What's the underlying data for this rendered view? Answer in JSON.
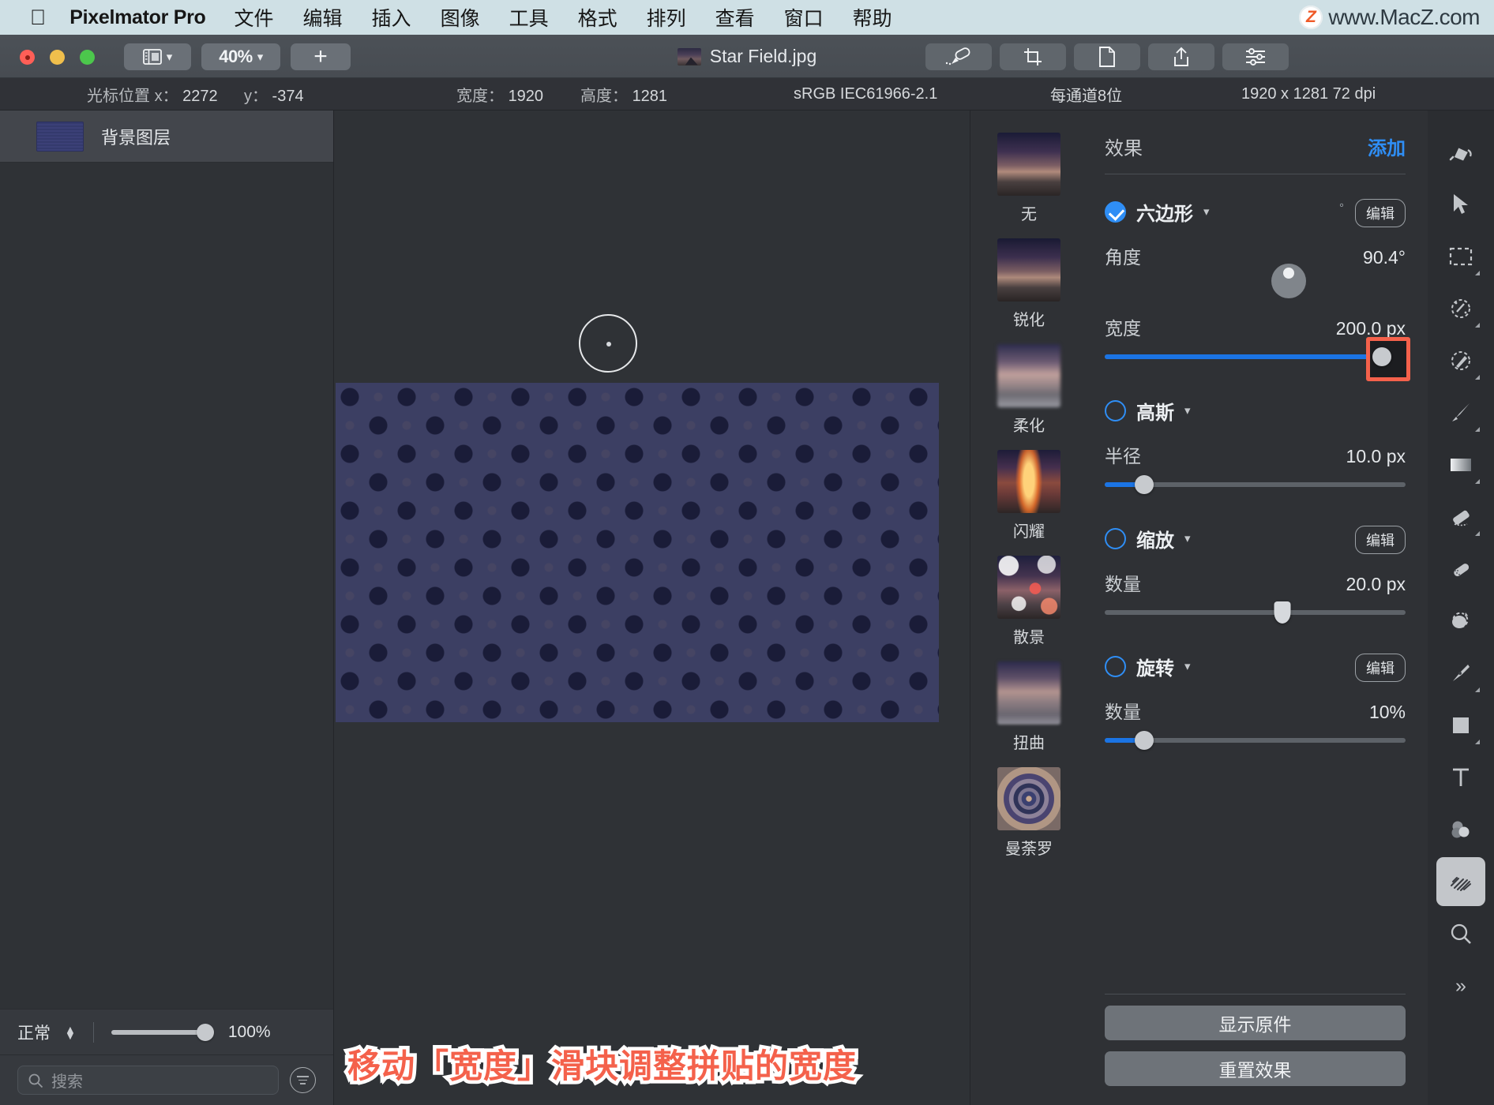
{
  "menubar": {
    "apple_icon": "apple-logo-icon",
    "app_name": "Pixelmator Pro",
    "items": [
      "文件",
      "编辑",
      "插入",
      "图像",
      "工具",
      "格式",
      "排列",
      "查看",
      "窗口",
      "帮助"
    ],
    "watermark_badge": "Z",
    "watermark_text": "www.MacZ.com"
  },
  "titlebar": {
    "zoom_level": "40%",
    "document_title": "Star Field.jpg",
    "add_label": "+",
    "tools": [
      "paint-tool-icon",
      "crop-tool-icon",
      "document-icon",
      "share-icon",
      "adjustments-icon"
    ]
  },
  "infobar": {
    "cursor_label": "光标位置",
    "x_label": "x：",
    "x_value": "2272",
    "y_label": "y：",
    "y_value": "-374",
    "width_label": "宽度：",
    "width_value": "1920",
    "height_label": "高度：",
    "height_value": "1281",
    "color_profile": "sRGB IEC61966-2.1",
    "bit_depth": "每通道8位",
    "dimensions_dpi": "1920 x 1281 72 dpi"
  },
  "left_panel": {
    "layer_name": "背景图层",
    "blend_mode": "正常",
    "opacity": "100%",
    "search_placeholder": "搜索"
  },
  "canvas": {
    "annotation": "移动「宽度」滑块调整拼贴的宽度"
  },
  "right_panel": {
    "effects_title": "效果",
    "add_label": "添加",
    "presets": [
      {
        "label": "无",
        "thumb": "t-none"
      },
      {
        "label": "锐化",
        "thumb": "t-sharp"
      },
      {
        "label": "柔化",
        "thumb": "t-soft"
      },
      {
        "label": "闪耀",
        "thumb": "t-glow"
      },
      {
        "label": "散景",
        "thumb": "t-bokeh"
      },
      {
        "label": "扭曲",
        "thumb": "t-twist"
      },
      {
        "label": "曼荼罗",
        "thumb": "t-mandala"
      }
    ],
    "effects": [
      {
        "name": "六边形",
        "enabled": true,
        "edit_label": "编辑",
        "params": [
          {
            "label": "角度",
            "value": "90.4°",
            "fill_pct": 0
          },
          {
            "label": "宽度",
            "value": "200.0 px",
            "fill_pct": 92
          }
        ]
      },
      {
        "name": "高斯",
        "enabled": false,
        "params": [
          {
            "label": "半径",
            "value": "10.0 px",
            "fill_pct": 13
          }
        ]
      },
      {
        "name": "缩放",
        "enabled": false,
        "edit_label": "编辑",
        "params": [
          {
            "label": "数量",
            "value": "20.0 px",
            "fill_pct": 59
          }
        ]
      },
      {
        "name": "旋转",
        "enabled": false,
        "edit_label": "编辑",
        "params": [
          {
            "label": "数量",
            "value": "10%",
            "fill_pct": 13
          }
        ]
      }
    ],
    "show_original_label": "显示原件",
    "reset_effects_label": "重置效果"
  },
  "toolstrip": {
    "tools": [
      "paint-bucket-icon",
      "arrow-select-icon",
      "rectangular-marquee-icon",
      "quick-selection-icon",
      "color-select-icon",
      "paintbrush-icon",
      "gradient-icon",
      "eraser-icon",
      "repair-icon",
      "clone-stamp-icon",
      "pen-tool-icon",
      "shape-icon",
      "text-tool-icon",
      "color-adjust-icon",
      "effects-icon",
      "zoom-tool-icon",
      "more-tools-icon"
    ],
    "active_index": 14,
    "more_label": "»"
  },
  "colors": {
    "accent_blue": "#2f8ef5",
    "slider_blue": "#1b74e4",
    "highlight_red": "#f4614b",
    "menubar_bg": "#cfe0e5"
  }
}
